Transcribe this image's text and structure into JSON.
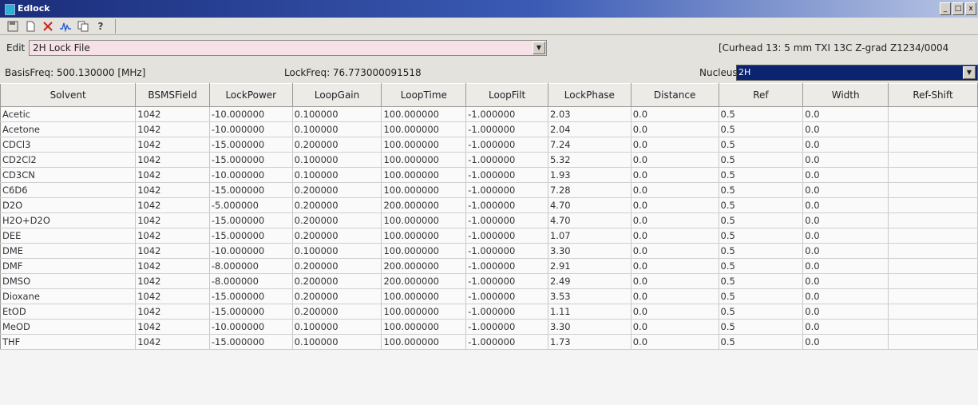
{
  "window": {
    "title": "Edlock",
    "buttons": [
      "_",
      "□",
      "x"
    ]
  },
  "toolbar": {
    "icons": [
      "save-icon",
      "new-file-icon",
      "cut-icon",
      "wave-icon",
      "copy-icon",
      "help-icon"
    ],
    "help_glyph": "?"
  },
  "edit": {
    "label": "Edit",
    "value": "2H Lock File",
    "probe": "[Curhead 13: 5 mm TXI 13C Z-grad Z1234/0004"
  },
  "info": {
    "basis_freq": "BasisFreq: 500.130000 [MHz]",
    "lock_freq": "LockFreq: 76.773000091518",
    "nucleus_label": "Nucleus",
    "nucleus_value": "2H"
  },
  "table": {
    "columns": [
      "Solvent",
      "BSMSField",
      "LockPower",
      "LoopGain",
      "LoopTime",
      "LoopFilt",
      "LockPhase",
      "Distance",
      "Ref",
      "Width",
      "Ref-Shift"
    ],
    "rows": [
      [
        "Acetic",
        "1042",
        "-10.000000",
        "0.100000",
        "100.000000",
        "-1.000000",
        "2.03",
        "0.0",
        "0.5",
        "0.0",
        ""
      ],
      [
        "Acetone",
        "1042",
        "-10.000000",
        "0.100000",
        "100.000000",
        "-1.000000",
        "2.04",
        "0.0",
        "0.5",
        "0.0",
        ""
      ],
      [
        "CDCl3",
        "1042",
        "-15.000000",
        "0.200000",
        "100.000000",
        "-1.000000",
        "7.24",
        "0.0",
        "0.5",
        "0.0",
        ""
      ],
      [
        "CD2Cl2",
        "1042",
        "-15.000000",
        "0.100000",
        "100.000000",
        "-1.000000",
        "5.32",
        "0.0",
        "0.5",
        "0.0",
        ""
      ],
      [
        "CD3CN",
        "1042",
        "-10.000000",
        "0.100000",
        "100.000000",
        "-1.000000",
        "1.93",
        "0.0",
        "0.5",
        "0.0",
        ""
      ],
      [
        "C6D6",
        "1042",
        "-15.000000",
        "0.200000",
        "100.000000",
        "-1.000000",
        "7.28",
        "0.0",
        "0.5",
        "0.0",
        ""
      ],
      [
        "D2O",
        "1042",
        "-5.000000",
        "0.200000",
        "200.000000",
        "-1.000000",
        "4.70",
        "0.0",
        "0.5",
        "0.0",
        ""
      ],
      [
        "H2O+D2O",
        "1042",
        "-15.000000",
        "0.200000",
        "100.000000",
        "-1.000000",
        "4.70",
        "0.0",
        "0.5",
        "0.0",
        ""
      ],
      [
        "DEE",
        "1042",
        "-15.000000",
        "0.200000",
        "100.000000",
        "-1.000000",
        "1.07",
        "0.0",
        "0.5",
        "0.0",
        ""
      ],
      [
        "DME",
        "1042",
        "-10.000000",
        "0.100000",
        "100.000000",
        "-1.000000",
        "3.30",
        "0.0",
        "0.5",
        "0.0",
        ""
      ],
      [
        "DMF",
        "1042",
        "-8.000000",
        "0.200000",
        "200.000000",
        "-1.000000",
        "2.91",
        "0.0",
        "0.5",
        "0.0",
        ""
      ],
      [
        "DMSO",
        "1042",
        "-8.000000",
        "0.200000",
        "200.000000",
        "-1.000000",
        "2.49",
        "0.0",
        "0.5",
        "0.0",
        ""
      ],
      [
        "Dioxane",
        "1042",
        "-15.000000",
        "0.200000",
        "100.000000",
        "-1.000000",
        "3.53",
        "0.0",
        "0.5",
        "0.0",
        ""
      ],
      [
        "EtOD",
        "1042",
        "-15.000000",
        "0.200000",
        "100.000000",
        "-1.000000",
        "1.11",
        "0.0",
        "0.5",
        "0.0",
        ""
      ],
      [
        "MeOD",
        "1042",
        "-10.000000",
        "0.100000",
        "100.000000",
        "-1.000000",
        "3.30",
        "0.0",
        "0.5",
        "0.0",
        ""
      ],
      [
        "THF",
        "1042",
        "-15.000000",
        "0.100000",
        "100.000000",
        "-1.000000",
        "1.73",
        "0.0",
        "0.5",
        "0.0",
        ""
      ]
    ]
  }
}
